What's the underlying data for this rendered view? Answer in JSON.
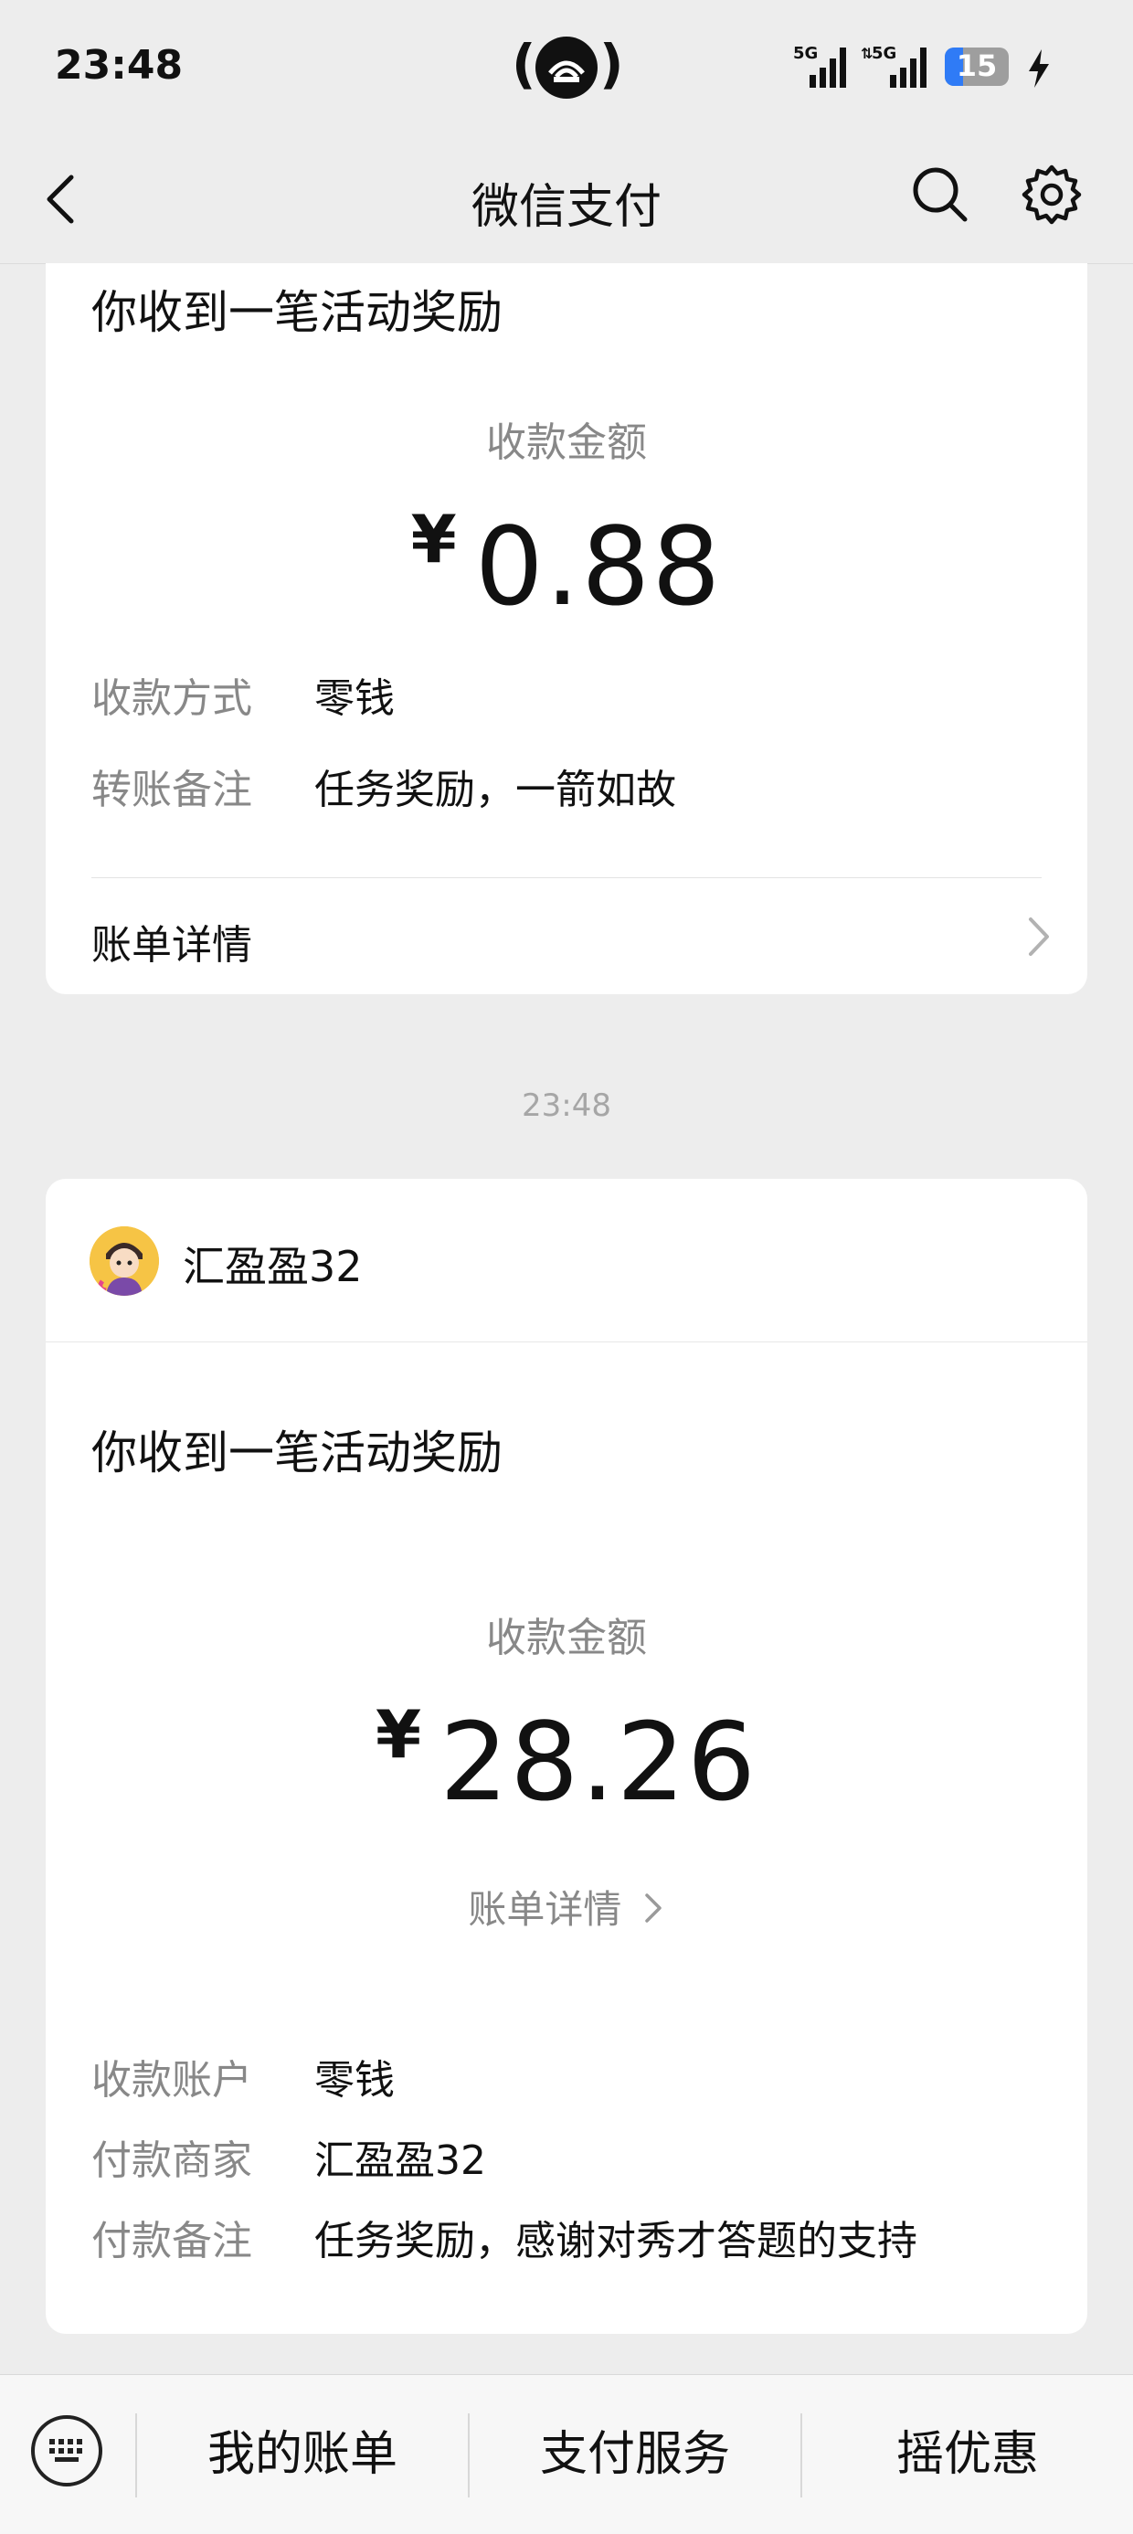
{
  "status_bar": {
    "time": "23:48",
    "battery": "15",
    "net1": "5G",
    "net2": "5G"
  },
  "nav": {
    "title": "微信支付"
  },
  "card1": {
    "title": "你收到一笔活动奖励",
    "amount_label": "收款金额",
    "currency": "¥",
    "amount": "0.88",
    "rows": [
      {
        "key": "收款方式",
        "value": "零钱"
      },
      {
        "key": "转账备注",
        "value": "任务奖励，一箭如故"
      }
    ],
    "bill_details": "账单详情"
  },
  "time_separator": "23:48",
  "card2": {
    "merchant": "汇盈盈32",
    "title": "你收到一笔活动奖励",
    "amount_label": "收款金额",
    "currency": "¥",
    "amount": "28.26",
    "bill_details": "账单详情",
    "rows": [
      {
        "key": "收款账户",
        "value": "零钱"
      },
      {
        "key": "付款商家",
        "value": "汇盈盈32"
      },
      {
        "key": "付款备注",
        "value": "任务奖励，感谢对秀才答题的支持"
      }
    ]
  },
  "bottom_bar": {
    "tabs": [
      "我的账单",
      "支付服务",
      "摇优惠"
    ]
  }
}
